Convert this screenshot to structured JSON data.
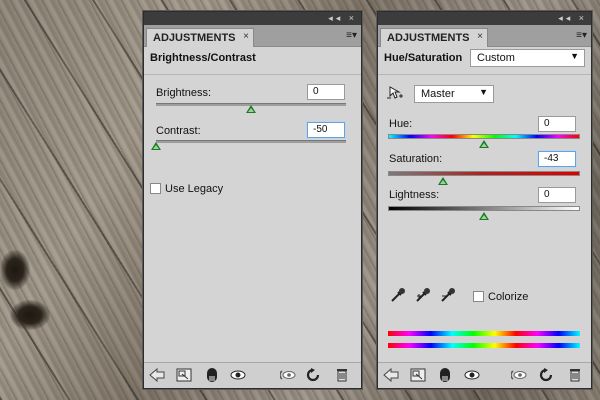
{
  "left_panel": {
    "tab_label": "ADJUSTMENTS",
    "tab_close": "×",
    "titlebar_icons": "◂◂ ×",
    "menu_icon": "≡▾",
    "heading": "Brightness/Contrast",
    "brightness": {
      "label": "Brightness:",
      "value": "0",
      "slider_fraction": 0.5
    },
    "contrast": {
      "label": "Contrast:",
      "value": "-50",
      "slider_fraction": 0.0
    },
    "use_legacy": {
      "label": "Use Legacy",
      "checked": false
    }
  },
  "right_panel": {
    "tab_label": "ADJUSTMENTS",
    "tab_close": "×",
    "titlebar_icons": "◂◂ ×",
    "menu_icon": "≡▾",
    "heading": "Hue/Saturation",
    "preset": {
      "selected": "Custom"
    },
    "channel": {
      "selected": "Master"
    },
    "hue": {
      "label": "Hue:",
      "value": "0",
      "slider_fraction": 0.5
    },
    "saturation": {
      "label": "Saturation:",
      "value": "-43",
      "slider_fraction": 0.285
    },
    "lightness": {
      "label": "Lightness:",
      "value": "0",
      "slider_fraction": 0.5
    },
    "colorize": {
      "label": "Colorize",
      "checked": false
    }
  },
  "colors": {
    "panel_bg": "#d4d4d4",
    "thumb": "#1c7a26",
    "focus_border": "#6aa0d8"
  },
  "footer_icons": [
    "back-arrow-icon",
    "clip-to-layer-icon",
    "layer-mask-icon",
    "eye-icon",
    "view-previous-state-icon",
    "reset-icon",
    "trash-icon"
  ]
}
